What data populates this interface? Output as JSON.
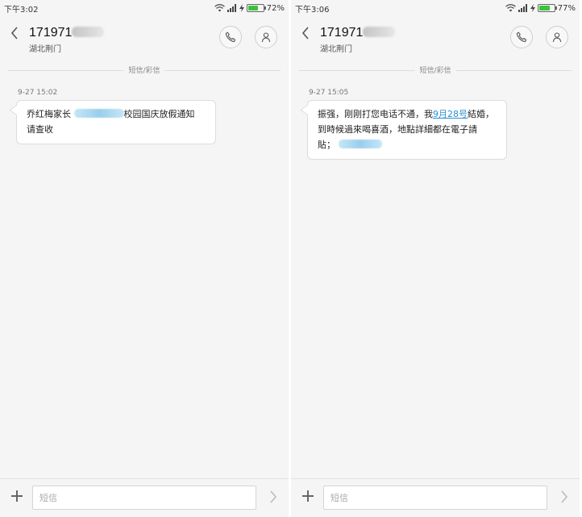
{
  "panels": [
    {
      "status": {
        "time": "下午3:02",
        "battery_pct": "72%",
        "battery_level": 0.72
      },
      "header": {
        "contact_prefix": "171971",
        "contact_suffix": "",
        "location": "湖北荆门"
      },
      "divider_label": "短信/彩信",
      "message": {
        "timestamp": "9-27 15:02",
        "line1_prefix": "乔红梅家长",
        "line1_suffix": "校园国庆放假通知",
        "line2": "请查收"
      },
      "compose": {
        "placeholder": "短信"
      }
    },
    {
      "status": {
        "time": "下午3:06",
        "battery_pct": "77%",
        "battery_level": 0.77
      },
      "header": {
        "contact_prefix": "171971",
        "contact_suffix": "",
        "location": "湖北荆门"
      },
      "divider_label": "短信/彩信",
      "message": {
        "timestamp": "9-27 15:05",
        "line1_prefix": "振强，刚刚打您电话不通，我",
        "line1_link": "9月28号",
        "line1_suffix": "結婚，",
        "line2": "到時候過來喝喜酒，地點詳細都在電子請",
        "line3": "貼；"
      },
      "compose": {
        "placeholder": "短信"
      }
    }
  ],
  "icons": {
    "back": "chevron-left-icon",
    "call": "phone-icon",
    "contact": "person-icon",
    "add": "plus-icon",
    "send": "chevron-right-icon",
    "wifi": "wifi-icon",
    "signal": "signal-icon",
    "charging": "bolt-icon",
    "battery": "battery-icon"
  },
  "colors": {
    "link": "#2a8fd6",
    "battery": "#3bc43b",
    "background": "#f5f5f5"
  }
}
